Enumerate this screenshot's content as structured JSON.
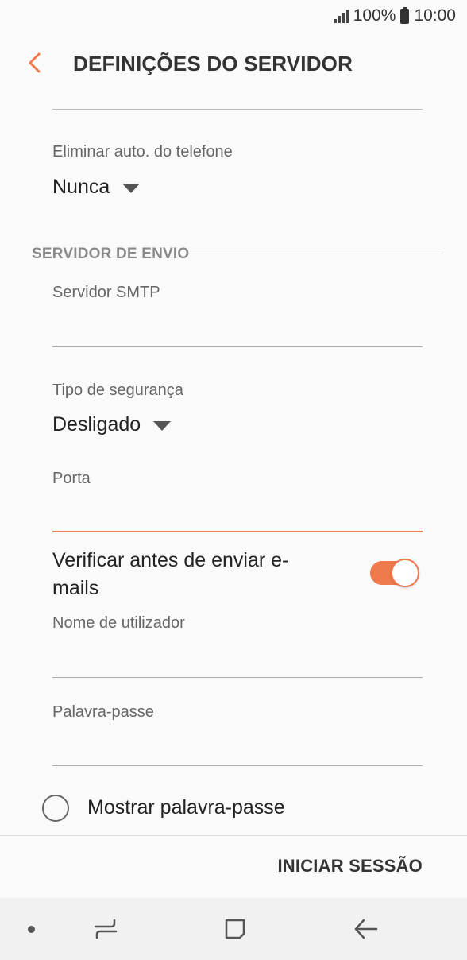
{
  "status_bar": {
    "battery_text": "100%",
    "time": "10:00",
    "icons": [
      "signal-icon",
      "battery-icon"
    ]
  },
  "header": {
    "title": "DEFINIÇÕES DO SERVIDOR",
    "back_icon": "chevron-left-icon"
  },
  "incoming": {
    "delete_label": "Eliminar auto. do telefone",
    "delete_value": "Nunca"
  },
  "outgoing": {
    "section_title": "SERVIDOR DE ENVIO",
    "smtp_label": "Servidor SMTP",
    "smtp_value": "",
    "security_label": "Tipo de segurança",
    "security_value": "Desligado",
    "port_label": "Porta",
    "port_value": "",
    "verify_label": "Verificar antes de enviar e-mails",
    "verify_on": true,
    "username_label": "Nome de utilizador",
    "username_value": "",
    "password_label": "Palavra-passe",
    "password_value": "",
    "show_password_label": "Mostrar palavra-passe",
    "show_password_checked": false
  },
  "footer": {
    "signin_label": "INICIAR SESSÃO"
  },
  "nav_bar": {
    "icons": [
      "recent-apps-icon",
      "home-icon",
      "back-icon"
    ]
  },
  "colors": {
    "accent": "#ef7a4d",
    "background": "#fafafa"
  }
}
